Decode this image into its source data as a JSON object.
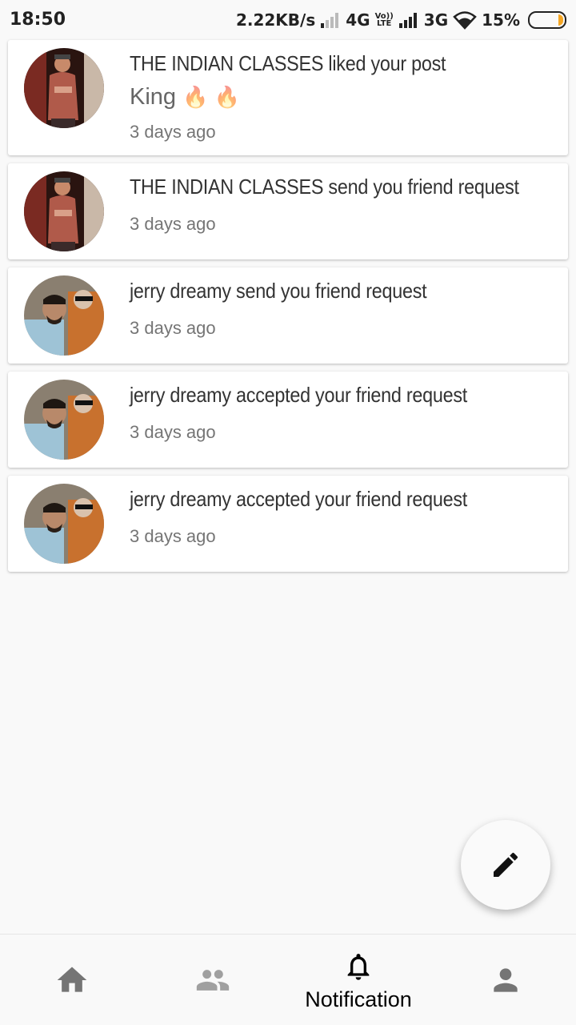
{
  "status_bar": {
    "time": "18:50",
    "net_speed": "2.22KB/s",
    "sim1_type": "4G",
    "volte_top": "Vo))",
    "volte_bottom": "LTE",
    "sim2_type": "3G",
    "battery_percent": "15%",
    "battery_level": 0.15
  },
  "notifications": [
    {
      "user": "THE INDIAN CLASSES",
      "message": "THE INDIAN CLASSES liked your post",
      "post_text": "King",
      "post_emoji": "🔥 🔥",
      "time": "3 days ago",
      "avatar": "user-a"
    },
    {
      "user": "THE INDIAN CLASSES",
      "message": "THE INDIAN CLASSES send you friend request",
      "time": "3 days ago",
      "avatar": "user-a"
    },
    {
      "user": "jerry dreamy",
      "message": "jerry dreamy send you friend request",
      "time": "3 days ago",
      "avatar": "user-b"
    },
    {
      "user": "jerry dreamy",
      "message": "jerry dreamy accepted your friend request",
      "time": "3 days ago",
      "avatar": "user-b"
    },
    {
      "user": "jerry dreamy",
      "message": "jerry dreamy accepted your friend request",
      "time": "3 days ago",
      "avatar": "user-b"
    }
  ],
  "fab": {
    "icon": "pencil-icon"
  },
  "bottom_nav": {
    "items": [
      {
        "icon": "home-icon",
        "label": ""
      },
      {
        "icon": "people-icon",
        "label": ""
      },
      {
        "icon": "bell-icon",
        "label": "Notification",
        "active": true
      },
      {
        "icon": "person-icon",
        "label": ""
      }
    ]
  },
  "colors": {
    "background": "#f9f9f9",
    "card": "#ffffff",
    "inactive_icon": "#757575",
    "active_icon": "#000000",
    "battery_fill": "#f5a623"
  }
}
